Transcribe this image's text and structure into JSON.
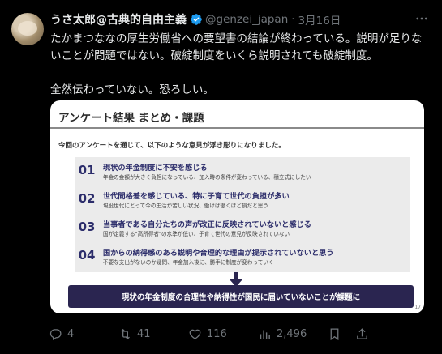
{
  "tweet": {
    "display_name": "うさ太郎@古典的自由主義",
    "handle": "@genzei_japan",
    "separator": "·",
    "date": "3月16日",
    "text": "たかまつななの厚生労働省への要望書の結論が終わっている。説明が足りないことが問題ではない。破綻制度をいくら説明されても破綻制度。\n\n全然伝わっていない。恐ろしい。"
  },
  "card": {
    "title": "アンケート結果 まとめ・課題",
    "intro": "今回のアンケートを通じて、以下のような意見が浮き彫りになりました。",
    "items": [
      {
        "num": "01",
        "main": "現状の年金制度に不安を感じる",
        "sub": "年金の金額が大きく負担になっている、加入時の条件が変わっている、積立式にしたい"
      },
      {
        "num": "02",
        "main": "世代間格差を感じている、特に子育て世代の負担が多い",
        "sub": "現役世代にとって今の生活が苦しい状況、働けば働くほど損だと思う"
      },
      {
        "num": "03",
        "main": "当事者である自分たちの声が改正に反映されていないと感じる",
        "sub": "国が定義する\"高所得者\"の水準が低い、子育て世代の意見が反映されていない"
      },
      {
        "num": "04",
        "main": "国からの納得感のある説明や合理的な理由が提示されていないと思う",
        "sub": "不要な支出がないのか疑問、年金加入後に、勝手に制度が変わっていく"
      }
    ],
    "conclusion": "現状の年金制度の合理性や納得性が国民に届いていないことが課題に",
    "page_number": "17"
  },
  "actions": {
    "replies": "4",
    "retweets": "41",
    "likes": "116",
    "views": "2,496"
  },
  "colors": {
    "background": "#000000",
    "text": "#e7e9ea",
    "muted": "#71767b",
    "verified": "#1d9bf0",
    "card_navy": "#2a2550"
  }
}
